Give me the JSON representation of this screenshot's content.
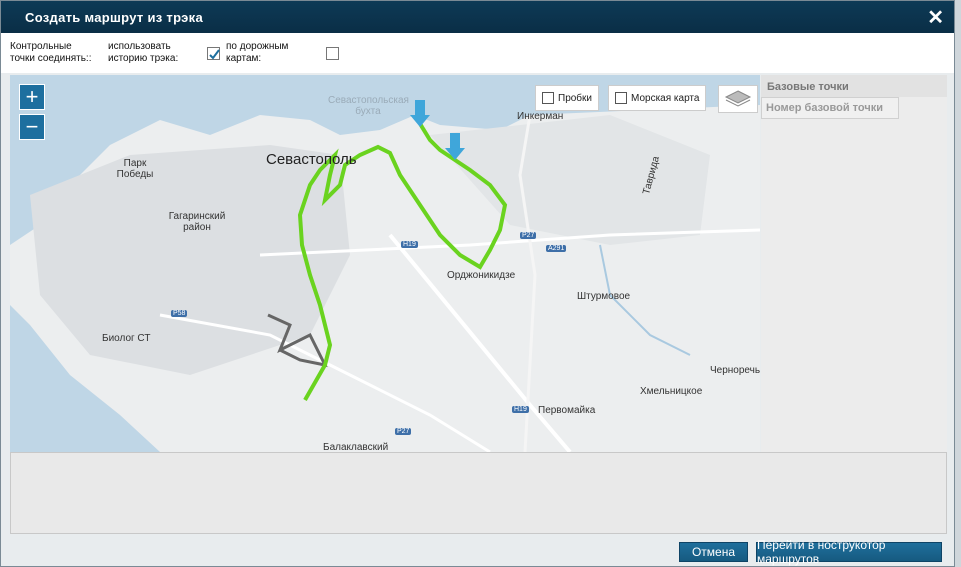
{
  "dialog": {
    "title": "Создать маршрут из трэка",
    "close": "✕"
  },
  "options": {
    "connect_label": "Контрольные точки соединять::",
    "history_label": "использовать историю трэка:",
    "history_checked": true,
    "roads_label": "по дорожным картам:",
    "roads_checked": false
  },
  "map": {
    "zoom_in": "+",
    "zoom_out": "−",
    "traffic_label": "Пробки",
    "marine_label": "Морская карта",
    "places": [
      {
        "name": "Севастопольская бухта",
        "kind": "blue"
      },
      {
        "name": "Инкерман",
        "kind": "normal"
      },
      {
        "name": "Парк Победы",
        "kind": "normal"
      },
      {
        "name": "Севастополь",
        "kind": "big"
      },
      {
        "name": "Гагаринский район",
        "kind": "normal"
      },
      {
        "name": "Орджоникидзе",
        "kind": "normal"
      },
      {
        "name": "Штурмовое",
        "kind": "normal"
      },
      {
        "name": "Биолог СТ",
        "kind": "normal"
      },
      {
        "name": "Таврида",
        "kind": "normal"
      },
      {
        "name": "Черноречье",
        "kind": "normal"
      },
      {
        "name": "Хмельницкое",
        "kind": "normal"
      },
      {
        "name": "Первомайка",
        "kind": "normal"
      },
      {
        "name": "Балаклавский",
        "kind": "normal"
      }
    ],
    "roads": [
      "H19",
      "P27",
      "A291",
      "P58",
      "H19",
      "P27"
    ]
  },
  "side": {
    "header": "Базовые точки",
    "column": "Номер базовой точки"
  },
  "buttons": {
    "cancel": "Отмена",
    "constructor": "Перейти в нострукотор маршрутов"
  },
  "colors": {
    "titlebar": "#0d3a56",
    "button": "#1f6f9c",
    "track_green": "#6ad31f",
    "track_gray": "#666666",
    "marker_blue": "#3fa6da"
  }
}
